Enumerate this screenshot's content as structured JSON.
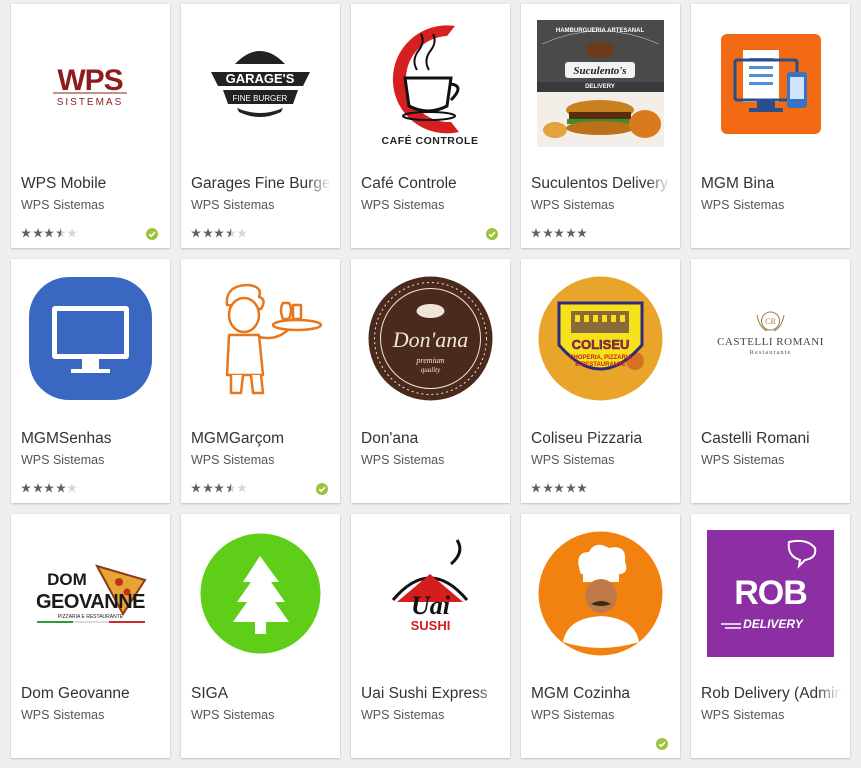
{
  "apps": [
    {
      "title": "WPS Mobile",
      "developer": "WPS Sistemas",
      "logo": "wps-logo",
      "logo_text": [
        "WPS",
        "SISTEMAS"
      ],
      "rating": 3.5,
      "verified": true
    },
    {
      "title": "Garages Fine Burger",
      "developer": "WPS Sistemas",
      "logo": "garages-logo",
      "logo_text": [
        "GARAGE'S",
        "FINE BURGER"
      ],
      "rating": 3.5,
      "verified": false
    },
    {
      "title": "Café Controle",
      "developer": "WPS Sistemas",
      "logo": "cafe-logo",
      "logo_text": [
        "CAFÉ CONTROLE"
      ],
      "rating": null,
      "verified": true
    },
    {
      "title": "Suculentos Delivery",
      "developer": "WPS Sistemas",
      "logo": "suculentos-logo",
      "logo_text": [
        "HAMBURGUERIA ARTESANAL",
        "Suculento's",
        "DELIVERY"
      ],
      "rating": 5,
      "verified": false
    },
    {
      "title": "MGM Bina",
      "developer": "WPS Sistemas",
      "logo": "mgm-bina-logo",
      "logo_text": [],
      "rating": null,
      "verified": false
    },
    {
      "title": "MGMSenhas",
      "developer": "WPS Sistemas",
      "logo": "monitor-icon",
      "logo_text": [],
      "rating": 4,
      "verified": false
    },
    {
      "title": "MGMGarçom",
      "developer": "WPS Sistemas",
      "logo": "waiter-logo",
      "logo_text": [],
      "rating": 3.5,
      "verified": true
    },
    {
      "title": "Don'ana",
      "developer": "WPS Sistemas",
      "logo": "donana-logo",
      "logo_text": [
        "Don'ana",
        "premium",
        "quality"
      ],
      "rating": null,
      "verified": false
    },
    {
      "title": "Coliseu Pizzaria",
      "developer": "WPS Sistemas",
      "logo": "coliseu-logo",
      "logo_text": [
        "COLISEU",
        "CHOPERIA, PIZZARIA",
        "E RESTAURANTE"
      ],
      "rating": 5,
      "verified": false
    },
    {
      "title": "Castelli Romani",
      "developer": "WPS Sistemas",
      "logo": "castelli-logo",
      "logo_text": [
        "CR",
        "CASTELLI ROMANI",
        "Restaurante"
      ],
      "rating": null,
      "verified": false
    },
    {
      "title": "Dom Geovanne",
      "developer": "WPS Sistemas",
      "logo": "dom-geovanne-logo",
      "logo_text": [
        "DOM",
        "GEOVANNE",
        "PIZZARIA E RESTAURANTE"
      ],
      "rating": null,
      "verified": false
    },
    {
      "title": "SIGA",
      "developer": "WPS Sistemas",
      "logo": "tree-icon",
      "logo_text": [],
      "rating": null,
      "verified": false
    },
    {
      "title": "Uai Sushi Express",
      "developer": "WPS Sistemas",
      "logo": "uai-sushi-logo",
      "logo_text": [
        "Uai",
        "SUSHI"
      ],
      "rating": null,
      "verified": false
    },
    {
      "title": "MGM Cozinha",
      "developer": "WPS Sistemas",
      "logo": "chef-logo",
      "logo_text": [],
      "rating": null,
      "verified": true
    },
    {
      "title": "Rob Delivery (Admin)",
      "developer": "WPS Sistemas",
      "logo": "rob-delivery-logo",
      "logo_text": [
        "ROB",
        "DELIVERY"
      ],
      "rating": null,
      "verified": false
    }
  ],
  "colors": {
    "star_filled": "#616161",
    "star_empty": "#d6d6d6",
    "verified_badge": "#9bc33d",
    "title_text": "#333333",
    "developer_text": "#555555"
  }
}
